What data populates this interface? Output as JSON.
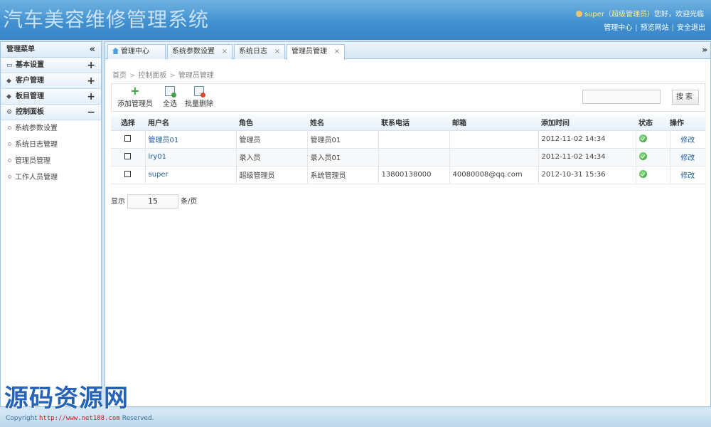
{
  "header": {
    "app_title": "汽车美容维修管理系统",
    "user_name": "super（超级管理员）",
    "greeting": "您好，欢迎光临",
    "links": [
      "管理中心",
      "预览网站",
      "安全退出"
    ]
  },
  "sidebar": {
    "title": "管理菜单",
    "collapse_glyph": "«",
    "groups": [
      {
        "label": "基本设置",
        "icon": "monitor-icon",
        "toggle": "+"
      },
      {
        "label": "客户管理",
        "icon": "diamond-icon",
        "toggle": "+"
      },
      {
        "label": "板目管理",
        "icon": "diamond-icon",
        "toggle": "+"
      },
      {
        "label": "控制面板",
        "icon": "gear-icon",
        "toggle": "−"
      }
    ],
    "items": [
      "系统参数设置",
      "系统日志管理",
      "管理员管理",
      "工作人员管理"
    ]
  },
  "tabs": [
    {
      "label": "管理中心",
      "closable": false
    },
    {
      "label": "系统参数设置",
      "closable": true
    },
    {
      "label": "系统日志",
      "closable": true
    },
    {
      "label": "管理员管理",
      "closable": true,
      "active": true
    }
  ],
  "tab_more_glyph": "»",
  "close_glyph": "×",
  "breadcrumb": [
    "首页",
    "控制面板",
    "管理员管理"
  ],
  "toolbar": {
    "add_label": "添加管理员",
    "select_all_label": "全选",
    "batch_delete_label": "批量删除",
    "search_button": "搜索",
    "search_value": ""
  },
  "table": {
    "headers": [
      "选择",
      "用户名",
      "角色",
      "姓名",
      "联系电话",
      "邮箱",
      "添加时间",
      "状态",
      "操作"
    ],
    "rows": [
      {
        "username": "管理员01",
        "role": "管理员",
        "name": "管理员01",
        "phone": "",
        "email": "",
        "added": "2012-11-02 14:34",
        "action": "修改"
      },
      {
        "username": "lry01",
        "role": "录入员",
        "name": "录入员01",
        "phone": "",
        "email": "",
        "added": "2012-11-02 14:34",
        "action": "修改"
      },
      {
        "username": "super",
        "role": "超级管理员",
        "name": "系统管理员",
        "phone": "13800138000",
        "email": "40080008@qq.com",
        "added": "2012-10-31 15:36",
        "action": "修改"
      }
    ]
  },
  "pager": {
    "prefix": "显示",
    "per_page": "15",
    "suffix": "条/页"
  },
  "footer": {
    "copyright_prefix": "Copyright",
    "url": "http://www.net188.com",
    "copyright_suffix": "Reserved."
  },
  "watermark": "源码资源网"
}
